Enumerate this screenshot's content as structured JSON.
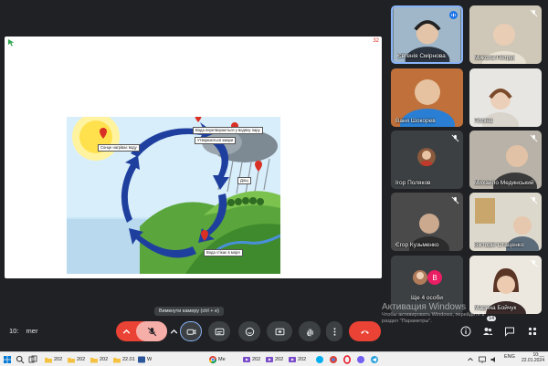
{
  "stage": {
    "corner_number": "32",
    "slide_labels": {
      "sun": "Сонце нагріває воду",
      "evaporation": "Вода перетворюється у водяну пару",
      "cloud": "Утворюються хмари",
      "rain": "Дощ",
      "water": "Вода стікає в моря"
    }
  },
  "participants": [
    {
      "name": "Євгенія Смірнова",
      "active": true
    },
    {
      "name": "Микола Петрук"
    },
    {
      "name": "Ваня Шокорев"
    },
    {
      "name": "Поліна"
    },
    {
      "name": "Ігор Поляков"
    },
    {
      "name": "Михайло Мединський"
    },
    {
      "name": "Єгор Кузьменко"
    },
    {
      "name": "Вікторія Стаценко"
    },
    {
      "name": "Ще 4 особи",
      "avatar_letter": "В"
    },
    {
      "name": "Марина Бойчук"
    }
  ],
  "watermark": {
    "title": "Активация Windows",
    "line1": "Чтобы активировать Windows, перейдите в",
    "line2": "раздел \"Параметры\"."
  },
  "toolbar": {
    "clock": "10:",
    "meeting_code": "mer",
    "camera_tooltip": "Вимкнути камеру (ctrl + e)",
    "people_count": "14"
  },
  "taskbar": {
    "items": [
      {
        "label": "202",
        "icon": "folder-icon"
      },
      {
        "label": "202",
        "icon": "folder-icon"
      },
      {
        "label": "202",
        "icon": "folder-icon"
      },
      {
        "label": "22.01",
        "icon": "folder-icon"
      },
      {
        "label": "W",
        "icon": "word-icon"
      },
      {
        "label": "Ме",
        "icon": "chrome-icon"
      },
      {
        "label": "202",
        "icon": "video-icon"
      },
      {
        "label": "202",
        "icon": "video-icon"
      },
      {
        "label": "202",
        "icon": "video-icon"
      }
    ],
    "lang": "ENG",
    "time": "10:__",
    "date": "22.01.2024"
  },
  "colors": {
    "accent": "#8ab4f8",
    "leave": "#ea4335",
    "meet_bg": "#202124",
    "fab": "#1a73e8"
  }
}
